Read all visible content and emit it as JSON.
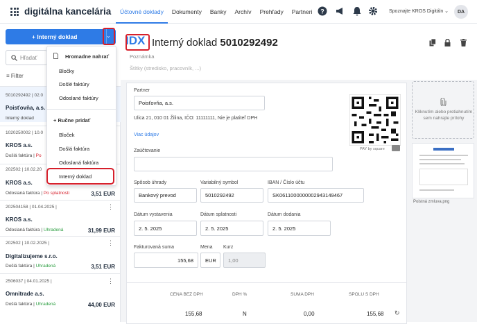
{
  "brand": "digitálna kancelária",
  "nav": [
    "Účtovné doklady",
    "Dokumenty",
    "Banky",
    "Archív",
    "Prehľady",
    "Partneri"
  ],
  "user": {
    "name": "Spoznajte KROS Digitáln",
    "initials": "DA"
  },
  "sidebar": {
    "new_button": "+ Interný doklad",
    "search_placeholder": "Hľadať",
    "filter": "Filter"
  },
  "list": [
    {
      "meta": "5010292492 | 02.0",
      "name": "Poisťovňa, a.s.",
      "type": "Interný doklad",
      "status": "",
      "amount": ""
    },
    {
      "meta": "1020250002 | 10.0",
      "name": "KROS a.s.",
      "type": "Došlá faktúra",
      "status": "Po",
      "amount": ""
    },
    {
      "meta": "202502 | 10.02.20",
      "name": "KROS a.s.",
      "type": "Odoslaná faktúra",
      "status": "Po splatnosti",
      "amount": "3,51 EUR"
    },
    {
      "meta": "202504158 | 01.04.2025 |",
      "name": "KROS a.s.",
      "type": "Odoslaná faktúra",
      "status": "Uhradená",
      "amount": "31,99 EUR"
    },
    {
      "meta": "202502 | 10.02.2025 |",
      "name": "Digitalizujeme s.r.o.",
      "type": "Došlá faktúra",
      "status": "Uhradená",
      "amount": "3,51 EUR"
    },
    {
      "meta": "2506037 | 04.01.2025 |",
      "name": "Omnitrade a.s.",
      "type": "Došlá faktúra",
      "status": "Uhradená",
      "amount": "44,00 EUR"
    }
  ],
  "menu": {
    "h1": "Hromadne nahrať",
    "items1": [
      "Bločky",
      "Došlé faktúry",
      "Odoslané faktúry"
    ],
    "h2": "+ Ručne pridať",
    "items2": [
      "Bloček",
      "Došlá faktúra",
      "Odoslaná faktúra",
      "Interný doklad"
    ]
  },
  "doc": {
    "code": "IDX",
    "title": "Interný doklad",
    "number": "5010292492",
    "poznamka": "Poznámka",
    "stitky": "Štítky (stredisko, pracovník, ...)"
  },
  "form": {
    "partner_label": "Partner",
    "partner": "Poisťovňa, a.s.",
    "address": "Ulica 21, 010 01 Žilina, IČO: 11111111, Nie je platiteľ DPH",
    "more": "Viac údajov",
    "zauct_label": "Zaúčtovanie",
    "pay_label": "Spôsob úhrady",
    "pay": "Bankový prevod",
    "vs_label": "Variabilný symbol",
    "vs": "5010292492",
    "iban_label": "IBAN / Číslo účtu",
    "iban": "SK0611000000002943149467",
    "dv_label": "Dátum vystavenia",
    "dv": "2. 5. 2025",
    "ds_label": "Dátum splatnosti",
    "ds": "2. 5. 2025",
    "dd_label": "Dátum dodania",
    "dd": "2. 5. 2025",
    "sum_label": "Fakturovaná suma",
    "sum": "155,68",
    "cur_label": "Mena",
    "cur": "EUR",
    "rate_label": "Kurz",
    "rate": "1,00",
    "pay_by_square": "PAY by square"
  },
  "totals": {
    "headers": [
      "CENA BEZ DPH",
      "DPH %",
      "SUMA DPH",
      "SPOLU S DPH"
    ],
    "values": [
      "155,68",
      "N",
      "0,00",
      "155,68"
    ]
  },
  "upload": "Kliknutím alebo pretiahnutím sem nahrajte prílohy",
  "attachment": "Poistná zmluva.png"
}
